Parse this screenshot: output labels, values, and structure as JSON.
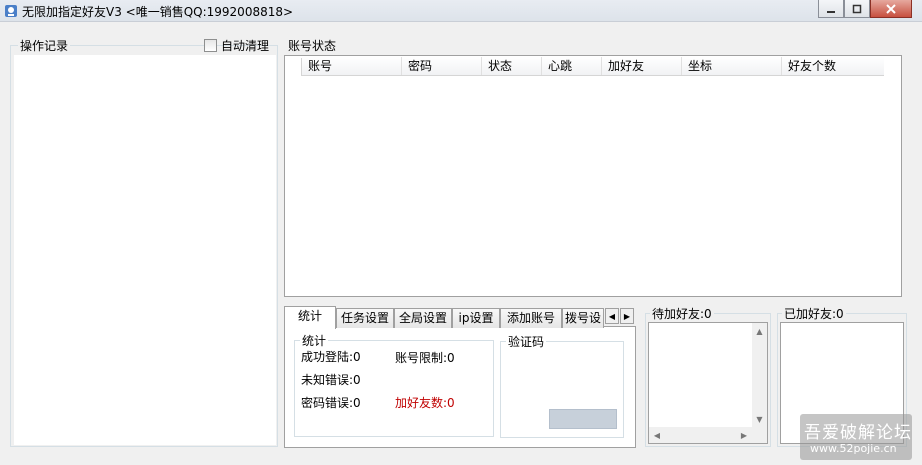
{
  "window": {
    "title": "无限加指定好友V3 <唯一销售QQ:1992008818>"
  },
  "left_panel": {
    "group_title": "操作记录",
    "auto_clear_label": "自动清理",
    "auto_clear_checked": false
  },
  "account_status": {
    "group_title": "账号状态",
    "columns": [
      "账号",
      "密码",
      "状态",
      "心跳",
      "加好友",
      "坐标",
      "好友个数"
    ]
  },
  "tabs": [
    {
      "label": "统计",
      "active": true
    },
    {
      "label": "任务设置",
      "active": false
    },
    {
      "label": "全局设置",
      "active": false
    },
    {
      "label": "ip设置",
      "active": false
    },
    {
      "label": "添加账号",
      "active": false
    },
    {
      "label": "拨号设",
      "active": false
    }
  ],
  "stats": {
    "group_title": "统计",
    "success_login_label": "成功登陆:",
    "success_login_value": "0",
    "account_limit_label": "账号限制:",
    "account_limit_value": "0",
    "unknown_error_label": "未知错误:",
    "unknown_error_value": "0",
    "password_error_label": "密码错误:",
    "password_error_value": "0",
    "add_friends_label": "加好友数:",
    "add_friends_value": "0",
    "add_friends_color": "#c00000"
  },
  "captcha": {
    "group_title": "验证码"
  },
  "pending": {
    "label": "待加好友:",
    "count": "0"
  },
  "added": {
    "label": "已加好友:",
    "count": "0"
  },
  "watermark": {
    "line1": "吾爱破解论坛",
    "line2": "www.52pojie.cn"
  }
}
